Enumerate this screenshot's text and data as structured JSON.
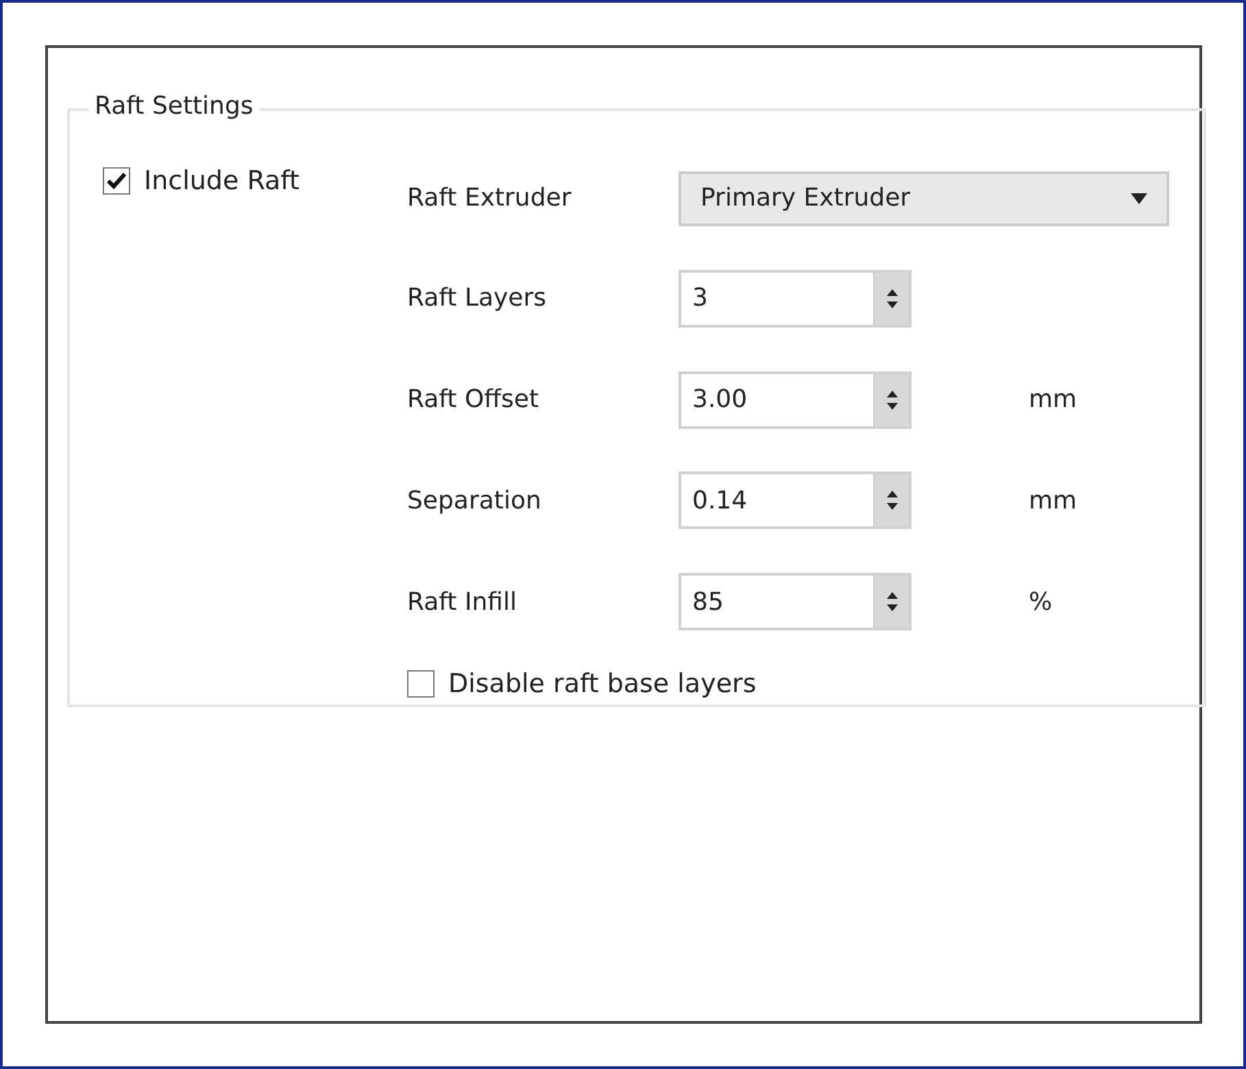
{
  "group": {
    "title": "Raft Settings"
  },
  "include_raft": {
    "label": "Include Raft",
    "checked": true
  },
  "extruder": {
    "label": "Raft Extruder",
    "value": "Primary Extruder"
  },
  "fields": [
    {
      "label": "Raft Layers",
      "value": "3"
    },
    {
      "label": "Raft Offset",
      "value": "3.00",
      "unit": "mm"
    },
    {
      "label": "Separation",
      "value": "0.14",
      "unit": "mm"
    },
    {
      "label": "Raft Infill",
      "value": "85",
      "unit": "%"
    }
  ],
  "disable_base": {
    "label": "Disable raft base layers",
    "checked": false
  }
}
